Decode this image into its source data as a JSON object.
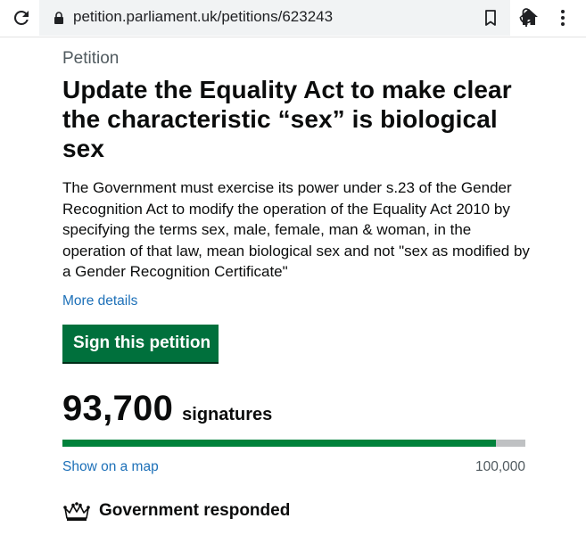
{
  "browser": {
    "url": "petition.parliament.uk/petitions/623243"
  },
  "page": {
    "caption": "Petition",
    "title": "Update the Equality Act to make clear the characteristic “sex” is biological sex",
    "summary": "The Government must exercise its power under s.23 of the Gender Recognition Act to modify the operation of the Equality Act 2010 by specifying the terms sex, male, female, man & woman, in the operation of that law, mean biological sex and not \"sex as modified by a Gender Recognition Certificate\"",
    "more_details_label": "More details",
    "sign_button_label": "Sign this petition"
  },
  "signatures": {
    "count_text": "93,700",
    "label": "signatures",
    "count": 93700,
    "threshold": 100000,
    "threshold_text": "100,000",
    "map_link_label": "Show on a map"
  },
  "government": {
    "label": "Government responded"
  },
  "colors": {
    "button_green": "#00703c",
    "progress_green": "#00823b",
    "link_blue": "#1d70b8"
  }
}
